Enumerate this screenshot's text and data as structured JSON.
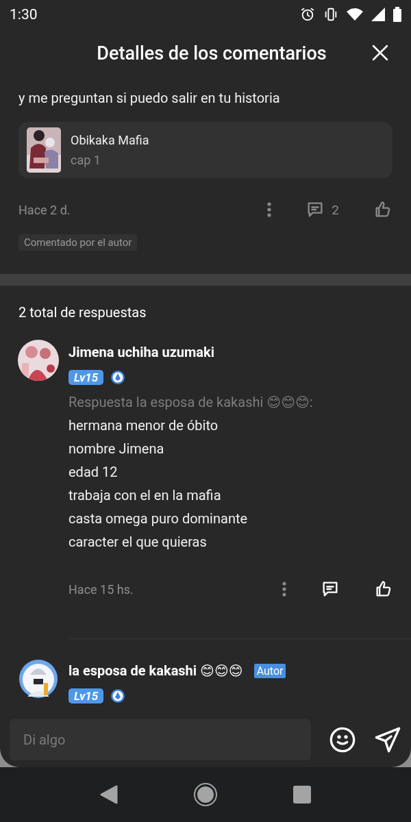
{
  "status_bar": {
    "time": "1:30"
  },
  "header": {
    "title": "Detalles de los comentarios"
  },
  "comment": {
    "text_tail": "y me preguntan si puedo salir en tu historia",
    "book": {
      "title": "Obikaka Mafia",
      "chapter": "cap 1"
    },
    "time": "Hace 2 d.",
    "reply_count": "2",
    "tag": "Comentado por el autor"
  },
  "replies_total": "2 total de respuestas",
  "replies": [
    {
      "name": "Jimena uchiha uzumaki",
      "level": "Lv15",
      "reply_to": "Respuesta la esposa de kakashi 😊😊😊:",
      "lines": [
        "hermana menor de óbito",
        "nombre Jimena",
        "edad 12",
        "trabaja con el en la mafia",
        "casta omega puro dominante",
        "caracter el que quieras"
      ],
      "time": "Hace 15 hs."
    },
    {
      "name": "la esposa de kakashi 😊😊😊",
      "level": "Lv15",
      "badge": "Autor"
    }
  ],
  "input": {
    "placeholder": "Di algo"
  }
}
